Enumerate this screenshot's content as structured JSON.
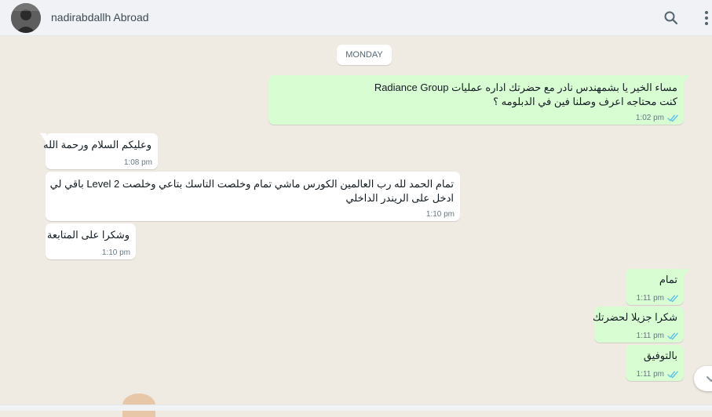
{
  "header": {
    "contact_name": "nadirabdallh Abroad",
    "avatar_icon": "contact-avatar",
    "search_icon": "search-icon",
    "menu_icon": "menu-dots-icon"
  },
  "chat": {
    "day_label": "MONDAY",
    "messages": [
      {
        "direction": "out",
        "lines": [
          "مساء الخير يا بشمهندس نادر  مع حضرتك اداره عمليات Radiance Group",
          "كنت محتاجه اعرف وصلنا فين في الدبلومه  ؟"
        ],
        "time": "1:02 pm",
        "status": "read"
      },
      {
        "direction": "in",
        "lines": [
          "وعليكم السلام ورحمة الله"
        ],
        "time": "1:08 pm"
      },
      {
        "direction": "in",
        "lines": [
          "تمام الحمد لله رب العالمين الكورس ماشي تمام وخلصت التاسك بتاعي وخلصت Level 2 باقي لي",
          "ادخل على الريندر الداخلي"
        ],
        "time": "1:10 pm"
      },
      {
        "direction": "in",
        "lines": [
          "وشكرا على المتابعة"
        ],
        "time": "1:10 pm"
      },
      {
        "direction": "out",
        "lines": [
          "تمام"
        ],
        "time": "1:11 pm",
        "status": "read"
      },
      {
        "direction": "out",
        "lines": [
          "شكرا جزيلا لحضرتك"
        ],
        "time": "1:11 pm",
        "status": "read"
      },
      {
        "direction": "out",
        "lines": [
          "بالتوفيق"
        ],
        "time": "1:11 pm",
        "status": "read"
      }
    ]
  },
  "colors": {
    "incoming_bubble": "#ffffff",
    "outgoing_bubble": "#d9fdd3",
    "chat_background": "#efeae2",
    "header_background": "#f0f2f5",
    "read_tick": "#53bdeb"
  },
  "icons": {
    "read_receipt": "double-check-icon",
    "scroll_down": "chevron-down-icon"
  }
}
